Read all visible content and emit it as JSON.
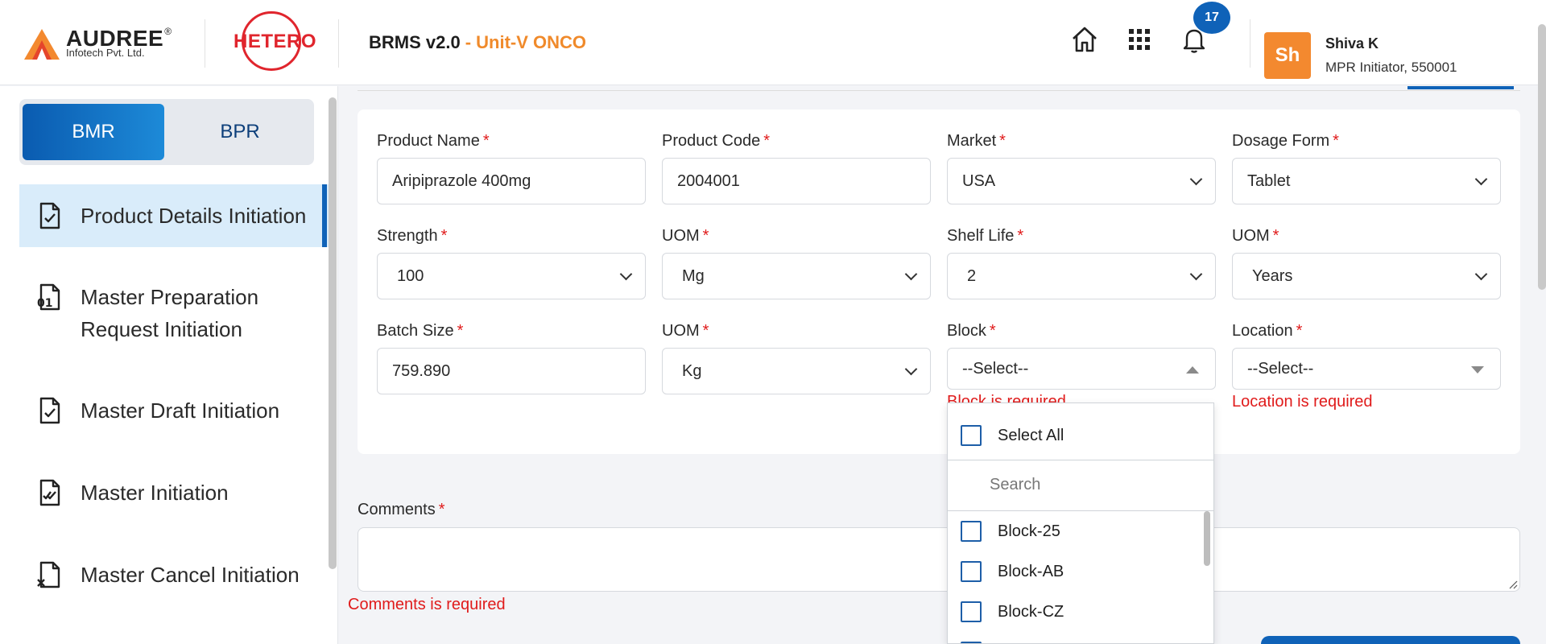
{
  "header": {
    "logo_audree": {
      "name": "AUDREE",
      "reg": "®",
      "subtitle": "Infotech Pvt. Ltd."
    },
    "logo_hetero": "HETERO",
    "app_name": "BRMS v2.0",
    "unit": "- Unit-V ONCO",
    "notification_count": "17",
    "user": {
      "initials": "Sh",
      "name": "Shiva K",
      "role": "MPR Initiator, 550001"
    },
    "colors": {
      "brand_blue": "#0f62b8",
      "accent_orange": "#f08a2b",
      "error_red": "#e01b1b"
    }
  },
  "sidebar": {
    "tabs": [
      {
        "label": "BMR",
        "active": true
      },
      {
        "label": "BPR",
        "active": false
      }
    ],
    "items": [
      {
        "label": "Product Details Initiation",
        "icon": "file-check-icon",
        "active": true
      },
      {
        "label": "Master Preparation Request Initiation",
        "icon": "file-binary-icon",
        "active": false
      },
      {
        "label": "Master Draft Initiation",
        "icon": "file-check-icon",
        "active": false
      },
      {
        "label": "Master Initiation",
        "icon": "file-double-check-icon",
        "active": false
      },
      {
        "label": "Master Cancel Initiation",
        "icon": "file-x-icon",
        "active": false
      }
    ]
  },
  "form": {
    "product_name": {
      "label": "Product Name",
      "value": "Aripiprazole 400mg"
    },
    "product_code": {
      "label": "Product Code",
      "value": "2004001"
    },
    "market": {
      "label": "Market",
      "value": "USA"
    },
    "dosage_form": {
      "label": "Dosage Form",
      "value": "Tablet"
    },
    "strength": {
      "label": "Strength",
      "value": "100"
    },
    "strength_uom": {
      "label": "UOM",
      "value": "Mg"
    },
    "shelf_life": {
      "label": "Shelf Life",
      "value": "2"
    },
    "shelf_life_uom": {
      "label": "UOM",
      "value": "Years"
    },
    "batch_size": {
      "label": "Batch Size",
      "value": "759.890"
    },
    "batch_uom": {
      "label": "UOM",
      "value": "Kg"
    },
    "block": {
      "label": "Block",
      "value": "--Select--",
      "error": "Block is required"
    },
    "location": {
      "label": "Location",
      "value": "--Select--",
      "error": "Location is required"
    },
    "required_mark": "*"
  },
  "block_dropdown": {
    "select_all": "Select All",
    "search_placeholder": "Search",
    "options": [
      "Block-25",
      "Block-AB",
      "Block-CZ"
    ]
  },
  "comments": {
    "label": "Comments",
    "error": "Comments is required"
  }
}
